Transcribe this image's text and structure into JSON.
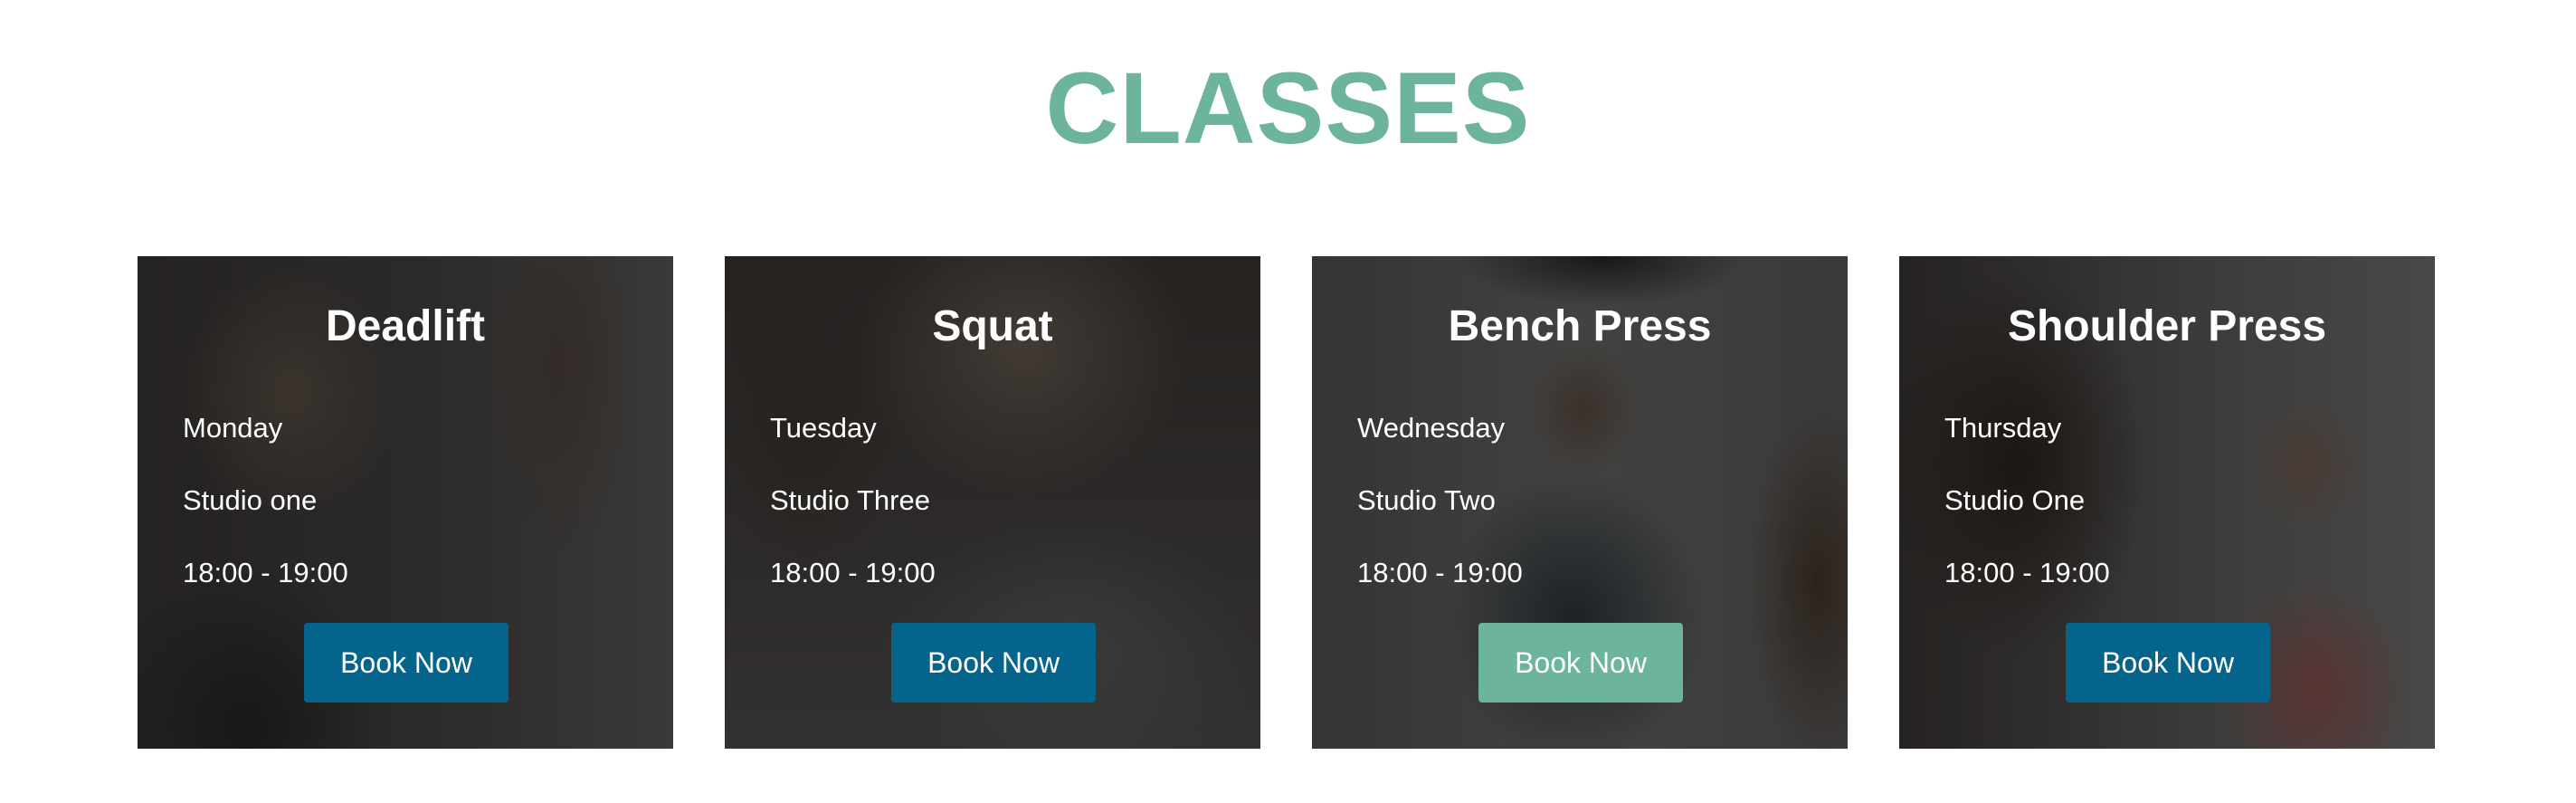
{
  "section": {
    "title": "CLASSES"
  },
  "colors": {
    "accent_green": "#6cb49a",
    "button_blue": "#05648c",
    "text_white": "#ffffff"
  },
  "classes": [
    {
      "name": "Deadlift",
      "day": "Monday",
      "studio": "Studio one",
      "time": "18:00 - 19:00",
      "button_label": "Book Now",
      "button_state": "default"
    },
    {
      "name": "Squat",
      "day": "Tuesday",
      "studio": "Studio Three",
      "time": "18:00 - 19:00",
      "button_label": "Book Now",
      "button_state": "default"
    },
    {
      "name": "Bench Press",
      "day": "Wednesday",
      "studio": "Studio Two",
      "time": "18:00 - 19:00",
      "button_label": "Book Now",
      "button_state": "hover"
    },
    {
      "name": "Shoulder Press",
      "day": "Thursday",
      "studio": "Studio One",
      "time": "18:00 - 19:00",
      "button_label": "Book Now",
      "button_state": "default"
    }
  ]
}
